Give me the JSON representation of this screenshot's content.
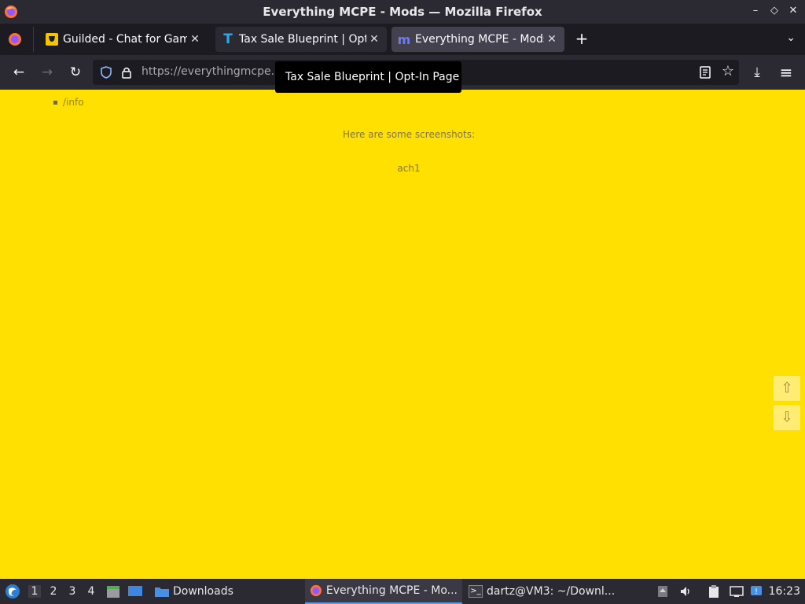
{
  "window": {
    "title": "Everything MCPE - Mods — Mozilla Firefox",
    "controls": [
      "–",
      "◇",
      "✕"
    ]
  },
  "tabs": [
    {
      "label": "Guilded - Chat for Gamin",
      "favicon": "guilded-icon",
      "close": "✕"
    },
    {
      "label": "Tax Sale Blueprint | Opt-",
      "favicon": "T",
      "close": "✕"
    },
    {
      "label": "Everything MCPE - Mods",
      "favicon": "m",
      "close": "✕"
    }
  ],
  "new_tab": "+",
  "tab_list": "⌄",
  "nav": {
    "back": "←",
    "forward": "→",
    "reload": "↻",
    "url": "https://everythingmcpe.",
    "download": "⤓",
    "menu": "≡"
  },
  "tooltip": "Tax Sale Blueprint | Opt-In Page",
  "page": {
    "list_item": "/info",
    "screenshots_heading": "Here are some screenshots:",
    "image_alt": "ach1",
    "scroll_up": "⇧",
    "scroll_down": "⇩"
  },
  "colors": {
    "page_background": "#ffe000",
    "chrome_dark": "#1c1b22",
    "chrome_mid": "#2b2a33",
    "active_tab": "#42414d"
  },
  "taskbar": {
    "workspaces": [
      "1",
      "2",
      "3",
      "4"
    ],
    "downloads": "Downloads",
    "task_firefox": "Everything MCPE - Mo...",
    "task_terminal": "dartz@VM3: ~/Downl...",
    "clock": "16:23"
  }
}
